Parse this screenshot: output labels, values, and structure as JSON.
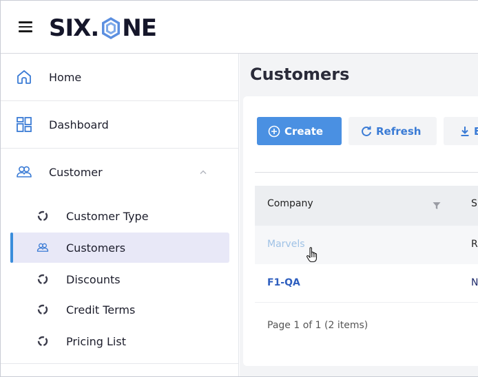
{
  "header": {
    "logo_left": "SIX.",
    "logo_right": "NE",
    "logo_text": "SIX.ONE"
  },
  "sidebar": {
    "items": [
      {
        "label": "Home",
        "icon": "home-icon"
      },
      {
        "label": "Dashboard",
        "icon": "dashboard-icon"
      },
      {
        "label": "Customer",
        "icon": "customer-group-icon",
        "expanded": true
      }
    ],
    "sub_items": [
      {
        "label": "Customer Type",
        "icon": "ring-icon",
        "active": false
      },
      {
        "label": "Customers",
        "icon": "customer-group-icon",
        "active": true
      },
      {
        "label": "Discounts",
        "icon": "ring-icon",
        "active": false
      },
      {
        "label": "Credit Terms",
        "icon": "ring-icon",
        "active": false
      },
      {
        "label": "Pricing List",
        "icon": "ring-icon",
        "active": false
      }
    ]
  },
  "main": {
    "title": "Customers",
    "toolbar": {
      "create_label": "Create",
      "refresh_label": "Refresh",
      "export_label": "E"
    },
    "table": {
      "columns": [
        "Company",
        "S"
      ],
      "rows": [
        {
          "company": "Marvels",
          "second": "R"
        },
        {
          "company": "F1-QA",
          "second": "N"
        }
      ]
    },
    "pager": "Page 1 of 1 (2 items)"
  },
  "colors": {
    "primary": "#4a90e2",
    "accent": "#3a7bd5",
    "active_bg": "#e8e8f7",
    "active_bar": "#3a8ddb",
    "logo_hex": "#5b8fe0"
  }
}
